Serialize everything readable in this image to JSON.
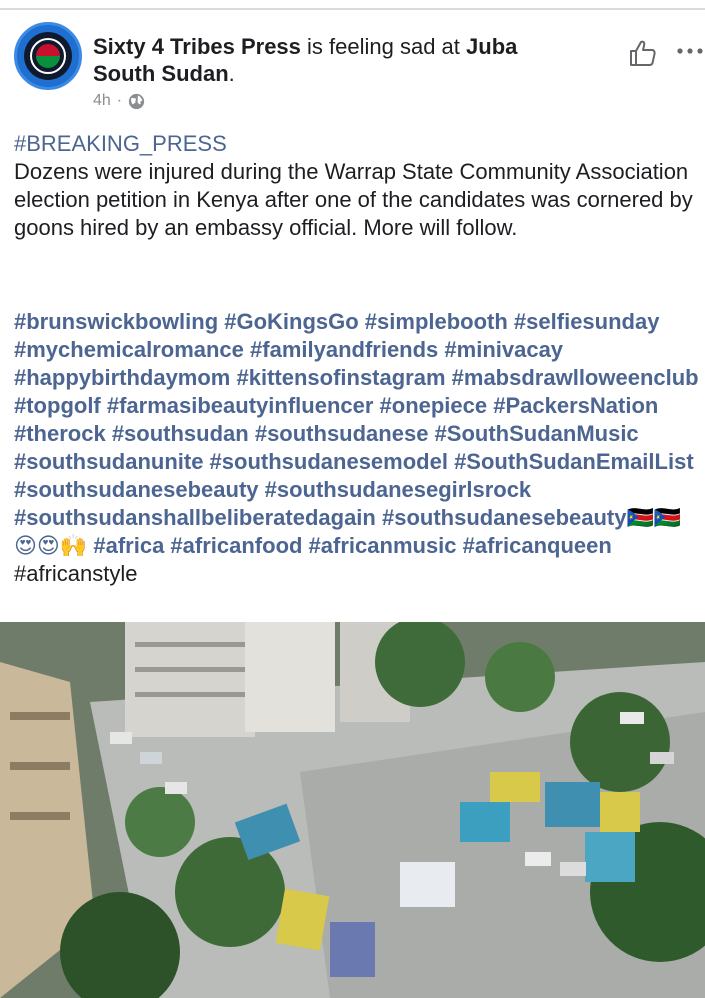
{
  "post": {
    "author": "Sixty 4 Tribes Press",
    "feeling_text": "is feeling sad at",
    "location": "Juba South Sudan",
    "time": "4h",
    "separator": "·",
    "headline_tag": "#BREAKING_PRESS",
    "message": "Dozens were injured during the Warrap State Community Association election petition in Kenya after one of the candidates was cornered by goons hired by an embassy official. More will follow.",
    "hashtags_line": "#brunswickbowling #GoKingsGo #simplebooth #selfiesunday #mychemicalromance #familyandfriends #minivacay #happybirthdaymom #kittensofinstagram #mabsdrawlloweenclub #topgolf #farmasibeautyinfluencer #onepiece #PackersNation #therock #southsudan #southsudanese #SouthSudanMusic #southsudanunite #southsudanesemodel #SouthSudanEmailList #southsudanesebeauty #southsudanesegirlsrock #southsudanshallbeliberatedagain #southsudanesebeauty🇸🇸🇸🇸😍😍🙌 #africa #africanfood #africanmusic #africanqueen",
    "last_tag": "#africanstyle"
  },
  "icons": {
    "avatar": "page-logo",
    "privacy": "globe-icon",
    "like": "thumbs-up-icon",
    "more": "more-icon"
  },
  "colors": {
    "hashtag": "#4c6591",
    "meta": "#8a8d91",
    "avatar_blue": "#1f6fd1"
  }
}
